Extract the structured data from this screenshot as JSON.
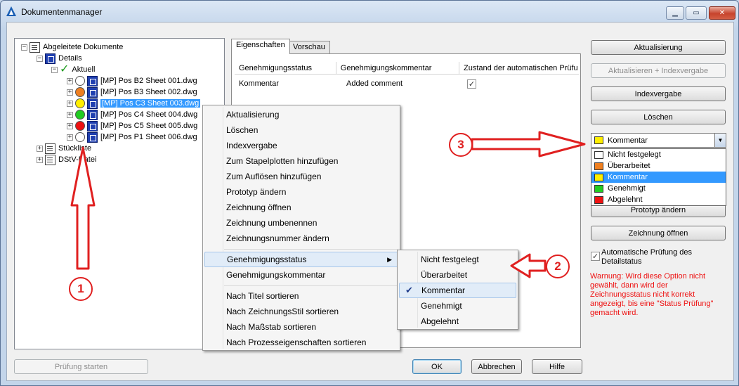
{
  "window": {
    "title": "Dokumentenmanager"
  },
  "tree": {
    "root": "Abgeleitete Dokumente",
    "details": "Details",
    "aktuell": "Aktuell",
    "files": [
      {
        "label": "[MP] Pos B2 Sheet 001.dwg",
        "status_color": "#ffffff"
      },
      {
        "label": "[MP] Pos B3 Sheet 002.dwg",
        "status_color": "#f08020"
      },
      {
        "label": "[MP] Pos C3 Sheet 003.dwg",
        "status_color": "#ffee00"
      },
      {
        "label": "[MP] Pos C4 Sheet 004.dwg",
        "status_color": "#22cc22"
      },
      {
        "label": "[MP] Pos C5 Sheet 005.dwg",
        "status_color": "#ee1111"
      },
      {
        "label": "[MP] Pos P1 Sheet 006.dwg",
        "status_color": "#ffffff"
      }
    ],
    "stueckliste": "Stückliste",
    "dstvdatei": "DStV-Datei"
  },
  "tabs": {
    "properties": "Eigenschaften",
    "preview": "Vorschau"
  },
  "grid": {
    "headers": [
      "Genehmigungsstatus",
      "Genehmigungskommentar",
      "Zustand der automatischen Prüfu"
    ],
    "row": {
      "status": "Kommentar",
      "comment": "Added comment"
    }
  },
  "buttons": {
    "update": "Aktualisierung",
    "update_index": "Aktualisieren + Indexvergabe",
    "index": "Indexvergabe",
    "delete": "Löschen",
    "prototype": "Prototyp ändern",
    "open_drawing": "Zeichnung öffnen",
    "start_check": "Prüfung starten",
    "ok": "OK",
    "cancel": "Abbrechen",
    "help": "Hilfe"
  },
  "combo": {
    "selected": "Kommentar",
    "selected_color": "#ffee00",
    "options": [
      {
        "label": "Nicht festgelegt",
        "color": "#ffffff"
      },
      {
        "label": "Überarbeitet",
        "color": "#f08020"
      },
      {
        "label": "Kommentar",
        "color": "#ffee00"
      },
      {
        "label": "Genehmigt",
        "color": "#22cc22"
      },
      {
        "label": "Abgelehnt",
        "color": "#ee1111"
      }
    ]
  },
  "checkbox": {
    "label": "Automatische Prüfung des Detailstatus",
    "checked": true
  },
  "warning": "Warnung: Wird diese Option nicht gewählt, dann wird der Zeichnungsstatus nicht korrekt angezeigt, bis eine \"Status Prüfung\" gemacht wird.",
  "context_menu": {
    "items": [
      "Aktualisierung",
      "Löschen",
      "Indexvergabe",
      "Zum Stapelplotten hinzufügen",
      "Zum Auflösen hinzufügen",
      "Prototyp ändern",
      "Zeichnung öffnen",
      "Zeichnung umbenennen",
      "Zeichnungsnummer ändern",
      "Genehmigungsstatus",
      "Genehmigungskommentar",
      "Nach Titel sortieren",
      "Nach ZeichnungsStil sortieren",
      "Nach Maßstab sortieren",
      "Nach Prozesseigenschaften sortieren"
    ]
  },
  "submenu": {
    "items": [
      "Nicht festgelegt",
      "Überarbeitet",
      "Kommentar",
      "Genehmigt",
      "Abgelehnt"
    ],
    "checked": "Kommentar"
  },
  "annotations": [
    "1",
    "2",
    "3"
  ]
}
